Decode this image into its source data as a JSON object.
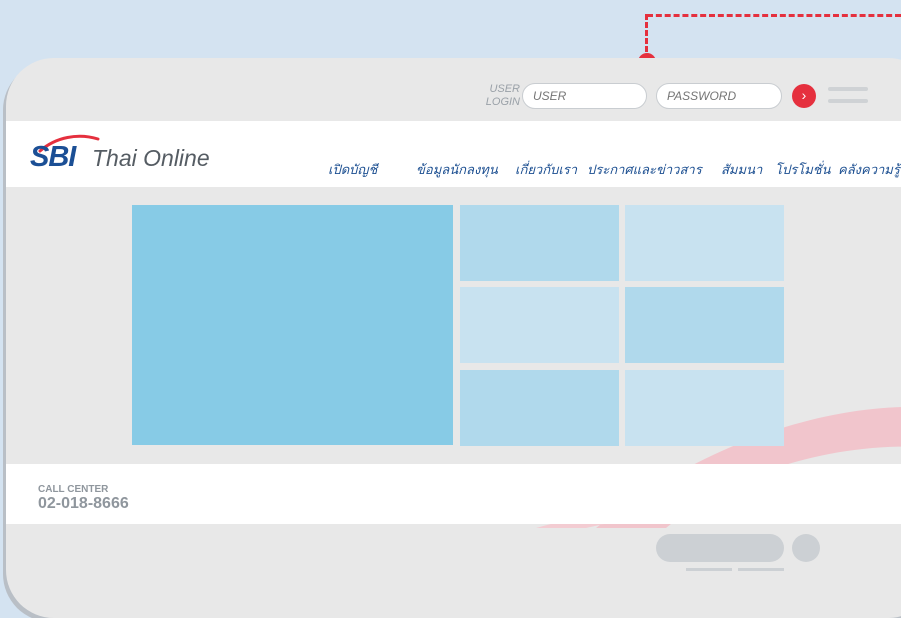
{
  "login": {
    "label_line1": "USER",
    "label_line2": "LOGIN",
    "user_placeholder": "USER",
    "password_placeholder": "PASSWORD",
    "go_glyph": "›",
    "go_icon": "chevron-right-icon",
    "menu_icon": "hamburger-menu-icon"
  },
  "brand": {
    "logo_mark": "SBI",
    "logo_text": "Thai Online"
  },
  "nav": {
    "items": [
      {
        "label": "เปิดบัญชี"
      },
      {
        "label": "ข้อมูลนักลงทุน"
      },
      {
        "label": "เกี่ยวกับเรา"
      },
      {
        "label": "ประกาศและข่าวสาร"
      },
      {
        "label": "สัมมนา"
      },
      {
        "label": "โปรโมชั่น"
      },
      {
        "label": "คลังความรู้"
      }
    ]
  },
  "footer": {
    "call_center_label": "CALL CENTER",
    "call_center_number": "02-018-8666"
  },
  "colors": {
    "accent_red": "#e5303e",
    "brand_blue": "#1b4f95",
    "tile_dark": "#87cbe6",
    "tile_mid": "#b0d9ec",
    "tile_light": "#c8e2f0"
  }
}
